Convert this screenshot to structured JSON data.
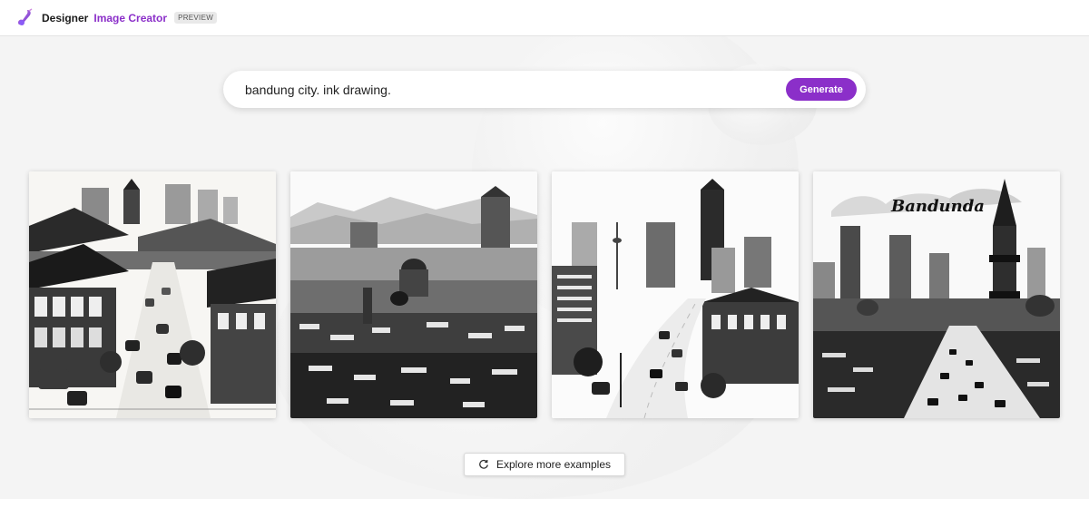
{
  "header": {
    "brand": "Designer",
    "product": "Image Creator",
    "badge": "PREVIEW"
  },
  "search": {
    "value": "bandung city. ink drawing.",
    "generate_label": "Generate"
  },
  "gallery": {
    "images": [
      {
        "name": "street-scene-image"
      },
      {
        "name": "hill-city-panorama-image"
      },
      {
        "name": "skyline-road-image"
      },
      {
        "name": "bandung-tower-image",
        "caption": "Bandunda"
      }
    ]
  },
  "explore": {
    "label": "Explore more examples",
    "icon": "refresh-icon"
  },
  "colors": {
    "accent": "#8b2fc9",
    "background": "#f4f4f4"
  }
}
